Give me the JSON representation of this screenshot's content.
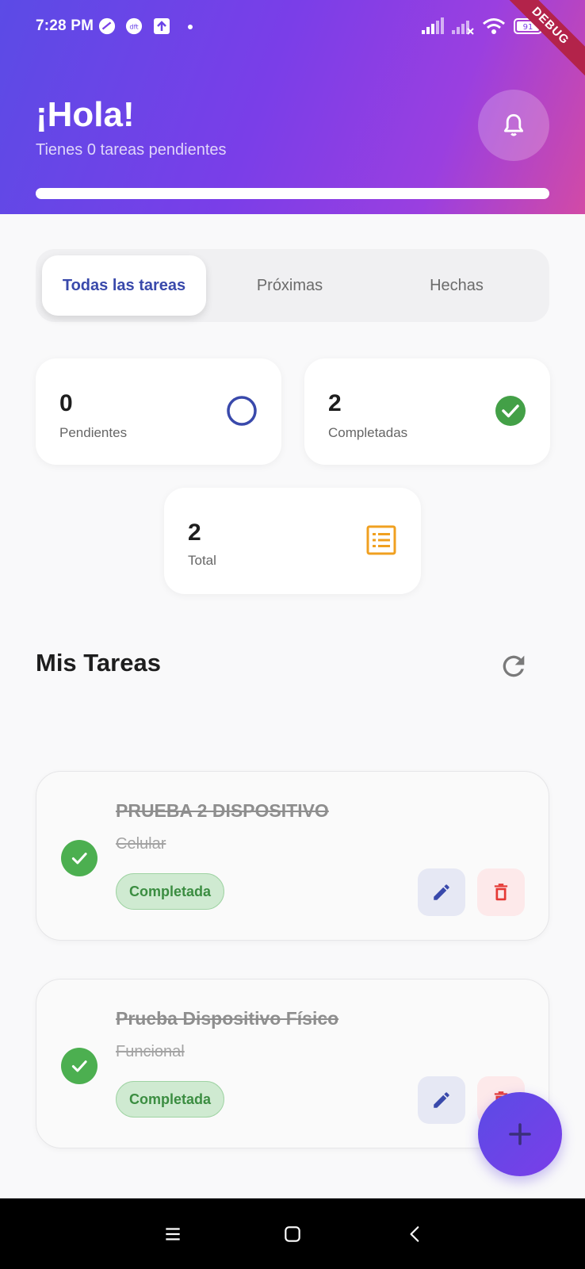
{
  "status_bar": {
    "time": "7:28 PM",
    "battery": "91",
    "icons": [
      "cloud-icon",
      "dft-icon",
      "upload-icon",
      "dot",
      "signal-icon",
      "signal-off-icon",
      "wifi-icon",
      "battery-icon"
    ]
  },
  "debug_banner": "DEBUG",
  "header": {
    "greeting": "¡Hola!",
    "subtitle": "Tienes 0 tareas pendientes",
    "progress_fraction": 1.0,
    "bell_icon": "bell-icon"
  },
  "tabs": [
    {
      "label": "Todas las tareas",
      "active": true
    },
    {
      "label": "Próximas",
      "active": false
    },
    {
      "label": "Hechas",
      "active": false
    }
  ],
  "stats": {
    "pending": {
      "value": "0",
      "label": "Pendientes",
      "icon": "circle-outline-icon",
      "color": "#3949ab"
    },
    "completed": {
      "value": "2",
      "label": "Completadas",
      "icon": "check-circle-icon",
      "color": "#43a047"
    },
    "total": {
      "value": "2",
      "label": "Total",
      "icon": "list-icon",
      "color": "#f0a020"
    }
  },
  "section": {
    "title": "Mis Tareas",
    "refresh_icon": "refresh-icon"
  },
  "tasks": [
    {
      "title": "PRUEBA 2 DISPOSITIVO",
      "description": "Celular",
      "status": "Completada"
    },
    {
      "title": "Prueba Dispositivo Físico",
      "description": "Funcional",
      "status": "Completada"
    }
  ],
  "colors": {
    "accent": "#5b4be6",
    "gradient_end": "#d24aa6",
    "success": "#4caf50",
    "danger": "#e53935",
    "edit": "#3949ab"
  },
  "fab_icon": "plus-icon",
  "nav": [
    "menu-icon",
    "home-icon",
    "back-icon"
  ]
}
